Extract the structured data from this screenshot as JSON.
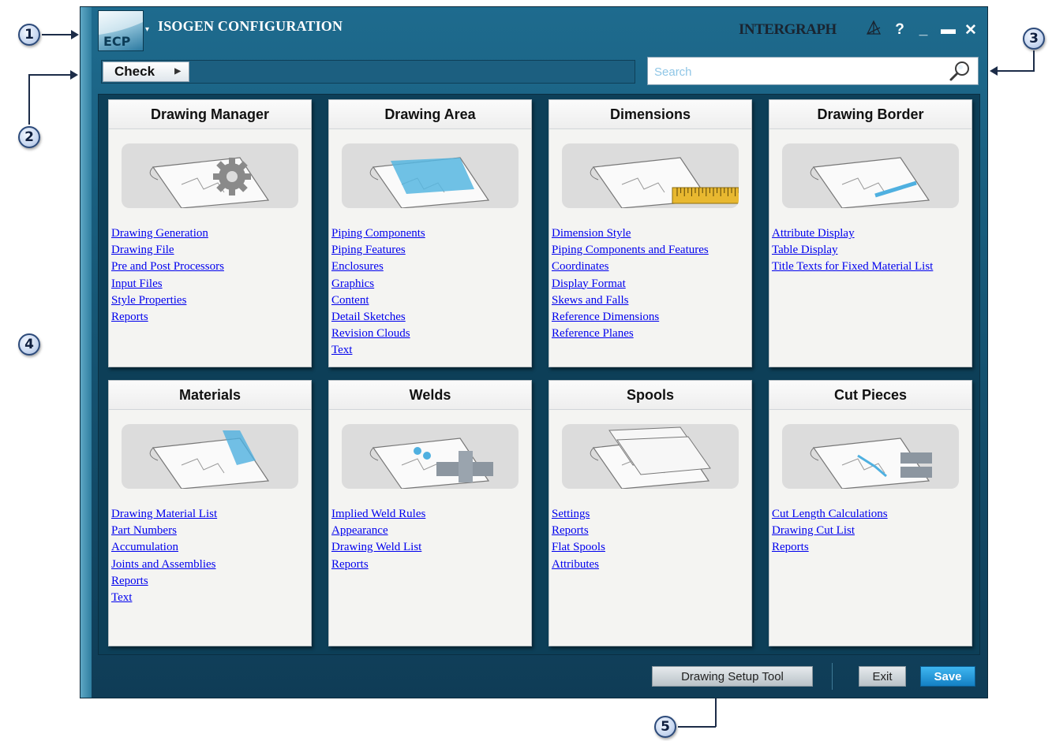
{
  "window": {
    "title": "ISOGEN CONFIGURATION",
    "logo_text": "ECP",
    "brand": "INTERGRAPH",
    "controls": [
      "?",
      "_",
      "▬",
      "✕"
    ]
  },
  "toolbar": {
    "check_label": "Check",
    "search_placeholder": "Search"
  },
  "callouts": [
    "1",
    "2",
    "3",
    "4",
    "5"
  ],
  "cards": [
    {
      "title": "Drawing Manager",
      "links": [
        "Drawing Generation",
        "Drawing File",
        "Pre and Post Processors",
        "Input Files",
        "Style Properties",
        "Reports"
      ]
    },
    {
      "title": "Drawing Area",
      "links": [
        "Piping Components",
        "Piping Features",
        "Enclosures",
        "Graphics",
        "Content",
        "Detail Sketches",
        "Revision Clouds",
        "Text"
      ]
    },
    {
      "title": "Dimensions",
      "links": [
        "Dimension Style",
        "Piping Components and Features",
        "Coordinates",
        "Display Format",
        "Skews and Falls",
        "Reference Dimensions",
        "Reference Planes"
      ]
    },
    {
      "title": "Drawing Border",
      "links": [
        "Attribute Display",
        "Table Display",
        "Title Texts for Fixed Material List"
      ]
    },
    {
      "title": "Materials",
      "links": [
        "Drawing Material List",
        "Part Numbers",
        "Accumulation",
        "Joints and Assemblies",
        "Reports",
        "Text"
      ]
    },
    {
      "title": "Welds",
      "links": [
        "Implied Weld Rules",
        "Appearance",
        "Drawing Weld List",
        "Reports"
      ]
    },
    {
      "title": "Spools",
      "links": [
        "Settings",
        "Reports",
        "Flat Spools",
        "Attributes"
      ]
    },
    {
      "title": "Cut Pieces",
      "links": [
        "Cut Length Calculations",
        "Drawing Cut List",
        "Reports"
      ]
    }
  ],
  "footer": {
    "drawing_setup_tool": "Drawing Setup Tool",
    "exit": "Exit",
    "save": "Save"
  },
  "colors": {
    "window_bg": "#14516f",
    "card_bg": "#f4f4f2",
    "link": "#0000ee",
    "save_button": "#1a8fd6"
  }
}
